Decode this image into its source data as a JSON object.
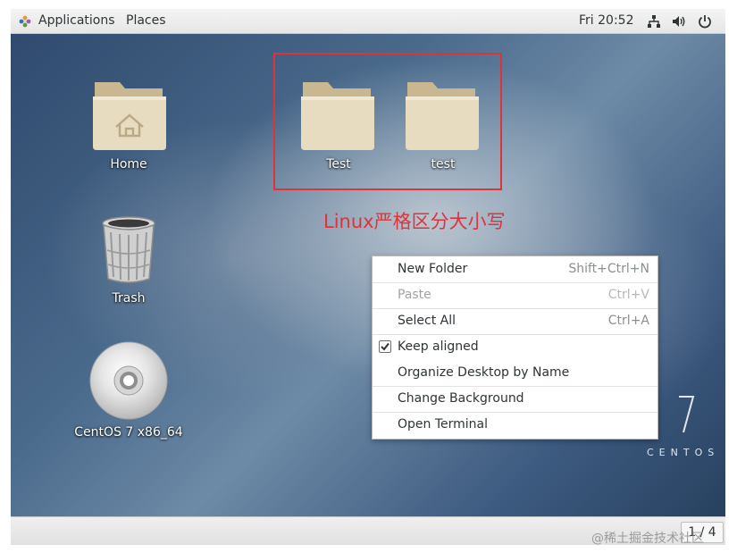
{
  "topbar": {
    "applications_label": "Applications",
    "places_label": "Places",
    "clock": "Fri 20:52",
    "icons": [
      "applications-logo-icon",
      "network-icon",
      "volume-icon",
      "power-icon"
    ]
  },
  "desktop": {
    "icons": [
      {
        "label": "Home",
        "icon": "home-folder-icon"
      },
      {
        "label": "Trash",
        "icon": "trash-icon"
      },
      {
        "label": "CentOS 7 x86_64",
        "icon": "optical-disc-icon"
      },
      {
        "label": "Test",
        "icon": "folder-icon"
      },
      {
        "label": "test",
        "icon": "folder-icon"
      }
    ],
    "annotation": "Linux严格区分大小写",
    "annotation_color": "#e0323b",
    "brand_number": "7",
    "brand_text": "CENTOS"
  },
  "context_menu": {
    "items": [
      {
        "label": "New Folder",
        "accel": "Shift+Ctrl+N",
        "enabled": true
      },
      {
        "label": "Paste",
        "accel": "Ctrl+V",
        "enabled": false
      },
      {
        "label": "Select All",
        "accel": "Ctrl+A",
        "enabled": true
      },
      {
        "label": "Keep aligned",
        "checked": true,
        "enabled": true
      },
      {
        "label": "Organize Desktop by Name",
        "enabled": true
      },
      {
        "label": "Change Background",
        "enabled": true
      },
      {
        "label": "Open Terminal",
        "enabled": true
      }
    ]
  },
  "bottombar": {
    "workspace_indicator": "1 / 4"
  },
  "watermark": "@稀土掘金技术社区"
}
